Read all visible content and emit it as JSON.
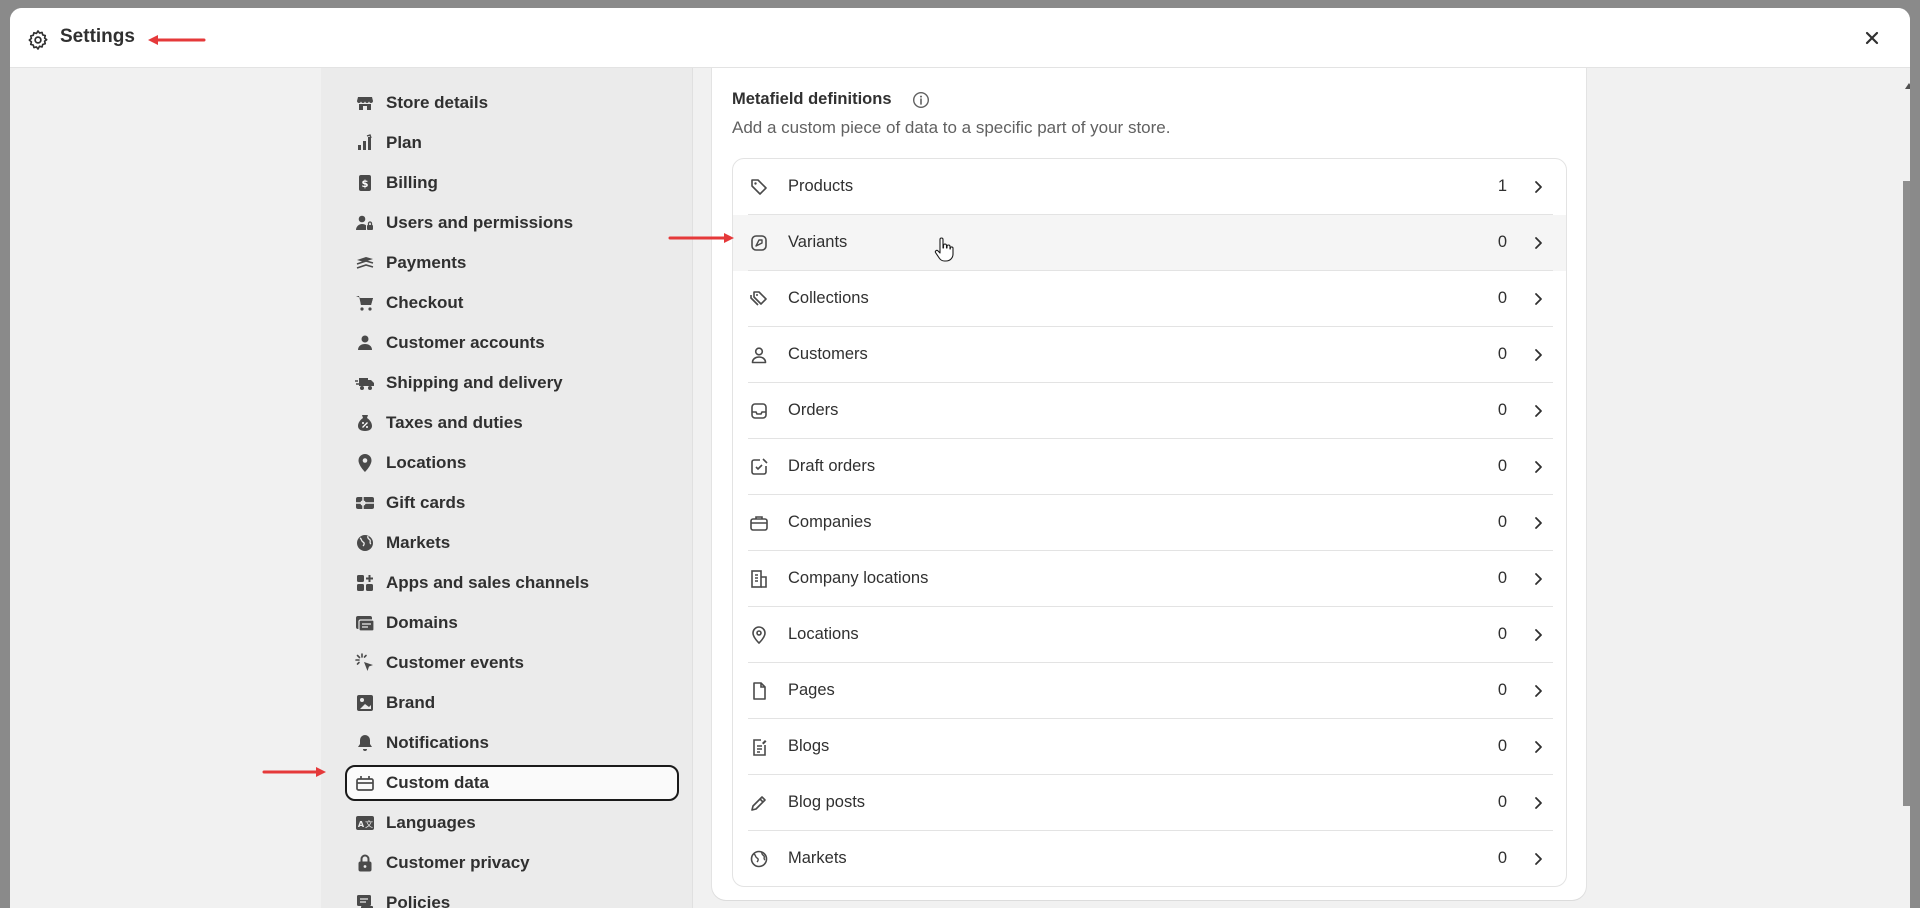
{
  "window": {
    "title": "Settings",
    "title_icon": "gear-icon",
    "close_icon": "close-icon"
  },
  "sidebar": {
    "items": [
      {
        "label": "Store details",
        "icon": "store-icon"
      },
      {
        "label": "Plan",
        "icon": "plan-icon"
      },
      {
        "label": "Billing",
        "icon": "billing-icon"
      },
      {
        "label": "Users and permissions",
        "icon": "users-icon"
      },
      {
        "label": "Payments",
        "icon": "payments-icon"
      },
      {
        "label": "Checkout",
        "icon": "cart-icon"
      },
      {
        "label": "Customer accounts",
        "icon": "person-icon"
      },
      {
        "label": "Shipping and delivery",
        "icon": "truck-icon"
      },
      {
        "label": "Taxes and duties",
        "icon": "tax-icon"
      },
      {
        "label": "Locations",
        "icon": "location-pin-icon"
      },
      {
        "label": "Gift cards",
        "icon": "gift-card-icon"
      },
      {
        "label": "Markets",
        "icon": "globe-icon"
      },
      {
        "label": "Apps and sales channels",
        "icon": "apps-icon"
      },
      {
        "label": "Domains",
        "icon": "domains-icon"
      },
      {
        "label": "Customer events",
        "icon": "cursor-click-icon"
      },
      {
        "label": "Brand",
        "icon": "brand-icon"
      },
      {
        "label": "Notifications",
        "icon": "bell-icon"
      },
      {
        "label": "Custom data",
        "icon": "custom-data-icon"
      },
      {
        "label": "Languages",
        "icon": "languages-icon"
      },
      {
        "label": "Customer privacy",
        "icon": "lock-icon"
      },
      {
        "label": "Policies",
        "icon": "policies-icon"
      }
    ],
    "active_label": "Custom data"
  },
  "main": {
    "title": "Metafield definitions",
    "info_icon": "info-icon",
    "description": "Add a custom piece of data to a specific part of your store.",
    "rows": [
      {
        "label": "Products",
        "count": "1",
        "icon": "tag-icon"
      },
      {
        "label": "Variants",
        "count": "0",
        "icon": "variant-tag-icon"
      },
      {
        "label": "Collections",
        "count": "0",
        "icon": "collection-tag-icon"
      },
      {
        "label": "Customers",
        "count": "0",
        "icon": "person-outline-icon"
      },
      {
        "label": "Orders",
        "count": "0",
        "icon": "inbox-icon"
      },
      {
        "label": "Draft orders",
        "count": "0",
        "icon": "draft-order-icon"
      },
      {
        "label": "Companies",
        "count": "0",
        "icon": "briefcase-icon"
      },
      {
        "label": "Company locations",
        "count": "0",
        "icon": "building-icon"
      },
      {
        "label": "Locations",
        "count": "0",
        "icon": "location-outline-icon"
      },
      {
        "label": "Pages",
        "count": "0",
        "icon": "page-icon"
      },
      {
        "label": "Blogs",
        "count": "0",
        "icon": "blog-icon"
      },
      {
        "label": "Blog posts",
        "count": "0",
        "icon": "pencil-icon"
      },
      {
        "label": "Markets",
        "count": "0",
        "icon": "globe-outline-icon"
      }
    ],
    "hovered_row": "Variants"
  },
  "colors": {
    "arrow": "#e5393a",
    "active_border": "#1a1a1a",
    "text": "#303030",
    "muted": "#616161"
  }
}
